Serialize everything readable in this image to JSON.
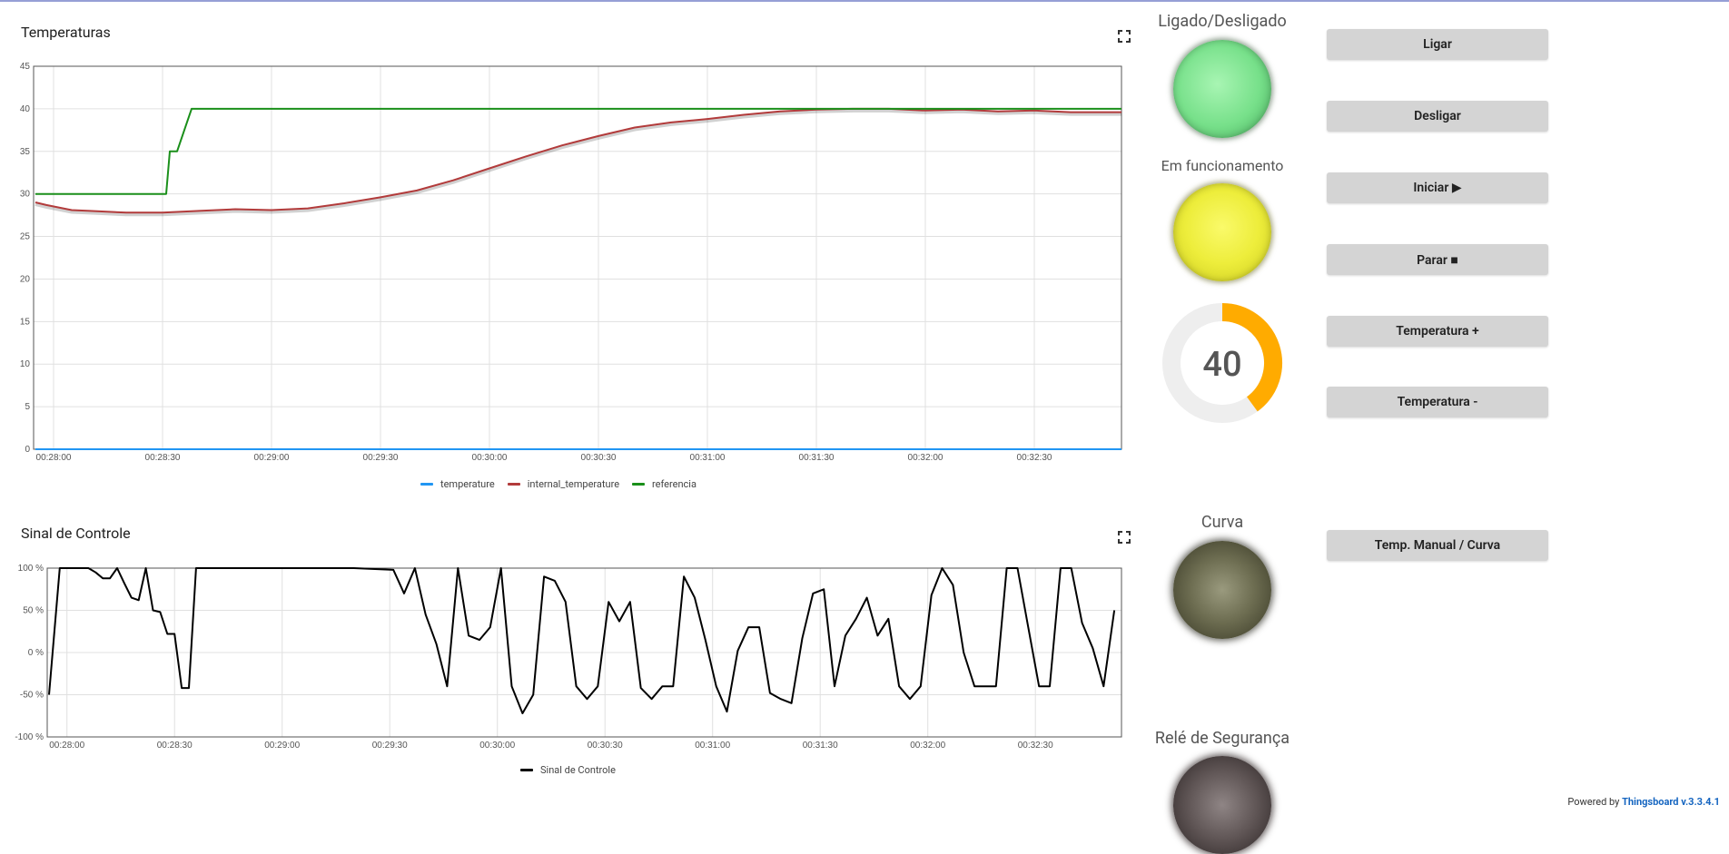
{
  "dashboard": {
    "temp_widget": {
      "title": "Temperaturas",
      "chart_data": {
        "type": "line",
        "title": "Temperaturas",
        "ylim": [
          0,
          45
        ],
        "yticks": [
          "0",
          "5",
          "10",
          "15",
          "20",
          "25",
          "30",
          "35",
          "40",
          "45"
        ],
        "x_ticks": [
          "00:28:00",
          "00:28:30",
          "00:29:00",
          "00:29:30",
          "00:30:00",
          "00:30:30",
          "00:31:00",
          "00:31:30",
          "00:32:00",
          "00:32:30"
        ],
        "x_range": [
          -5.5,
          294
        ],
        "grid": true,
        "legend_position": "bottom",
        "series": [
          {
            "name": "temperature",
            "color": "#2196f3",
            "x": [
              -5,
              294
            ],
            "y": [
              0,
              0
            ]
          },
          {
            "name": "internal_temperature",
            "color": "#b23b3b",
            "x": [
              -5,
              -2,
              5,
              10,
              20,
              30,
              40,
              50,
              60,
              70,
              80,
              90,
              100,
              110,
              120,
              130,
              140,
              150,
              160,
              170,
              180,
              190,
              200,
              210,
              220,
              230,
              240,
              250,
              260,
              270,
              280,
              294
            ],
            "y": [
              29,
              28.7,
              28.1,
              28.0,
              27.8,
              27.8,
              28.0,
              28.2,
              28.1,
              28.3,
              28.9,
              29.6,
              30.4,
              31.6,
              33.0,
              34.4,
              35.7,
              36.8,
              37.8,
              38.4,
              38.8,
              39.3,
              39.7,
              39.9,
              40.0,
              40.0,
              39.8,
              39.9,
              39.7,
              39.8,
              39.6,
              39.6
            ]
          },
          {
            "name": "referencia",
            "color": "#1a8f1a",
            "x": [
              -5,
              31,
              32,
              34,
              36,
              38,
              294
            ],
            "y": [
              30,
              30,
              35,
              35,
              37.5,
              40,
              40
            ]
          }
        ]
      }
    },
    "control_widget": {
      "title": "Sinal de Controle",
      "chart_data": {
        "type": "line",
        "title": "Sinal de Controle",
        "ylim": [
          -100,
          100
        ],
        "yticks": [
          "-100 %",
          "-50 %",
          "0 %",
          "50 %",
          "100 %"
        ],
        "x_ticks": [
          "00:28:00",
          "00:28:30",
          "00:29:00",
          "00:29:30",
          "00:30:00",
          "00:30:30",
          "00:31:00",
          "00:31:30",
          "00:32:00",
          "00:32:30"
        ],
        "x_range": [
          -5.5,
          294
        ],
        "grid": true,
        "legend_position": "bottom",
        "series": [
          {
            "name": "Sinal de Controle",
            "color": "#000000",
            "x": [
              -5,
              -2,
              1,
              3,
              6,
              8,
              10,
              12,
              14,
              16,
              18,
              20,
              22,
              24,
              26,
              28,
              30,
              32,
              34,
              36,
              38,
              40,
              80,
              91,
              94,
              97,
              100,
              103,
              106,
              109,
              112,
              115,
              118,
              121,
              124,
              127,
              130,
              133,
              136,
              139,
              142,
              145,
              148,
              151,
              154,
              157,
              160,
              163,
              166,
              169,
              172,
              175,
              178,
              181,
              184,
              187,
              190,
              193,
              196,
              199,
              202,
              205,
              208,
              211,
              214,
              217,
              220,
              223,
              226,
              229,
              232,
              235,
              238,
              241,
              244,
              247,
              250,
              253,
              256,
              259,
              262,
              265,
              268,
              271,
              274,
              277,
              280,
              283,
              286,
              289,
              292
            ],
            "y": [
              -50,
              100,
              100,
              100,
              100,
              95,
              88,
              88,
              100,
              82,
              65,
              62,
              100,
              50,
              48,
              22,
              22,
              -42,
              -42,
              100,
              100,
              100,
              100,
              98,
              70,
              100,
              45,
              10,
              -40,
              100,
              20,
              15,
              30,
              100,
              -40,
              -72,
              -50,
              90,
              85,
              60,
              -40,
              -55,
              -40,
              60,
              37,
              60,
              -42,
              -55,
              -40,
              -40,
              90,
              65,
              15,
              -40,
              -70,
              2,
              30,
              30,
              -48,
              -55,
              -60,
              17,
              70,
              75,
              -40,
              20,
              40,
              65,
              20,
              40,
              -40,
              -55,
              -40,
              68,
              100,
              80,
              0,
              -40,
              -40,
              -40,
              100,
              100,
              30,
              -40,
              -40,
              100,
              100,
              35,
              5,
              -40,
              50
            ]
          }
        ]
      }
    },
    "leds": [
      {
        "title": "Ligado/Desligado",
        "color": "#77e08a"
      },
      {
        "title": "Em funcionamento",
        "color": "#eded3b"
      },
      {
        "title": "Curva",
        "color": "#6e6e52"
      },
      {
        "title": "Relé de Segurança",
        "color": "#5f5555"
      }
    ],
    "gauge": {
      "value": 40,
      "min": 0,
      "max": 100,
      "color": "#ffab00",
      "track_color": "#eeeeee"
    },
    "buttons": {
      "ligar": "Ligar",
      "desligar": "Desligar",
      "iniciar": "Iniciar ▶",
      "parar": "Parar ■",
      "temp_mais": "Temperatura +",
      "temp_menos": "Temperatura -",
      "manual_curva": "Temp. Manual / Curva"
    },
    "footer": {
      "powered_by": "Powered by",
      "brand": "Thingsboard v.3.3.4.1"
    },
    "icons": {
      "fullscreen": "fullscreen-icon"
    }
  }
}
